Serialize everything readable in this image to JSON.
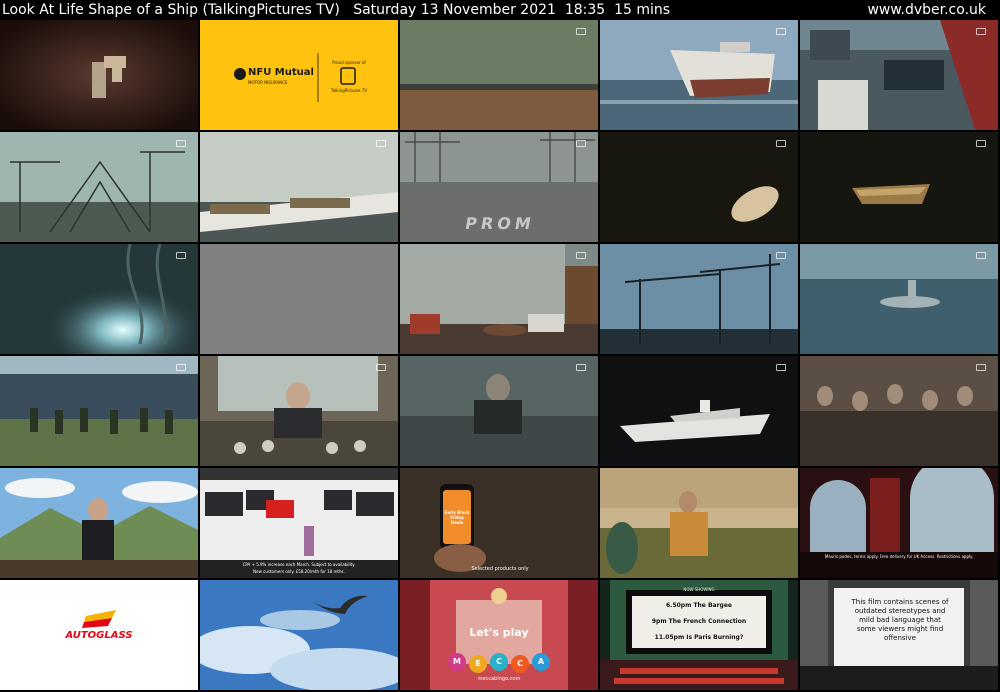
{
  "header": {
    "programme": "Look At Life Shape of a Ship (TalkingPictures TV)",
    "date": "Saturday 13 November 2021",
    "time": "18:35",
    "duration": "15 mins",
    "site": "www.dvber.co.uk"
  },
  "colors": {
    "background": "#000000",
    "header_text": "#ffffff",
    "nfu_yellow": "#ffc20e"
  },
  "overlays": {
    "nfu_brand": "NFU Mutual",
    "nfu_sub": "MOTOR INSURANCE",
    "sponsor_line": "Proud sponsor of",
    "channel_logo": "TalkingPictures TV",
    "shipyard_sign": "PROM",
    "tv_store_caption_1": "CPA + 5.9% increase each March. Subject to availability.",
    "tv_store_caption_2": "New customers only. £58.20/mth for 18 mths.",
    "phone_title": "Early Black Friday Deals",
    "phone_caption": "Selected products only",
    "ad_caption": "Mauris pedes, terms apply. Free delivery for UK Access. Restrictions apply.",
    "brand_autoglass": "AUTOGLASS",
    "mecca_lets_play": "Let's play",
    "mecca_letters": [
      "M",
      "E",
      "C",
      "C",
      "A"
    ],
    "mecca_url": "meccabingo.com",
    "cinema_heading": "NOW SHOWING",
    "cinema_line_1": "6.50pm The Bargee",
    "cinema_line_2": "9pm The French Connection",
    "cinema_line_3": "11.05pm Is Paris Burning?",
    "warning_text": "This film contains scenes of outdated stereotypes and mild bad language that some viewers might find offensive"
  }
}
